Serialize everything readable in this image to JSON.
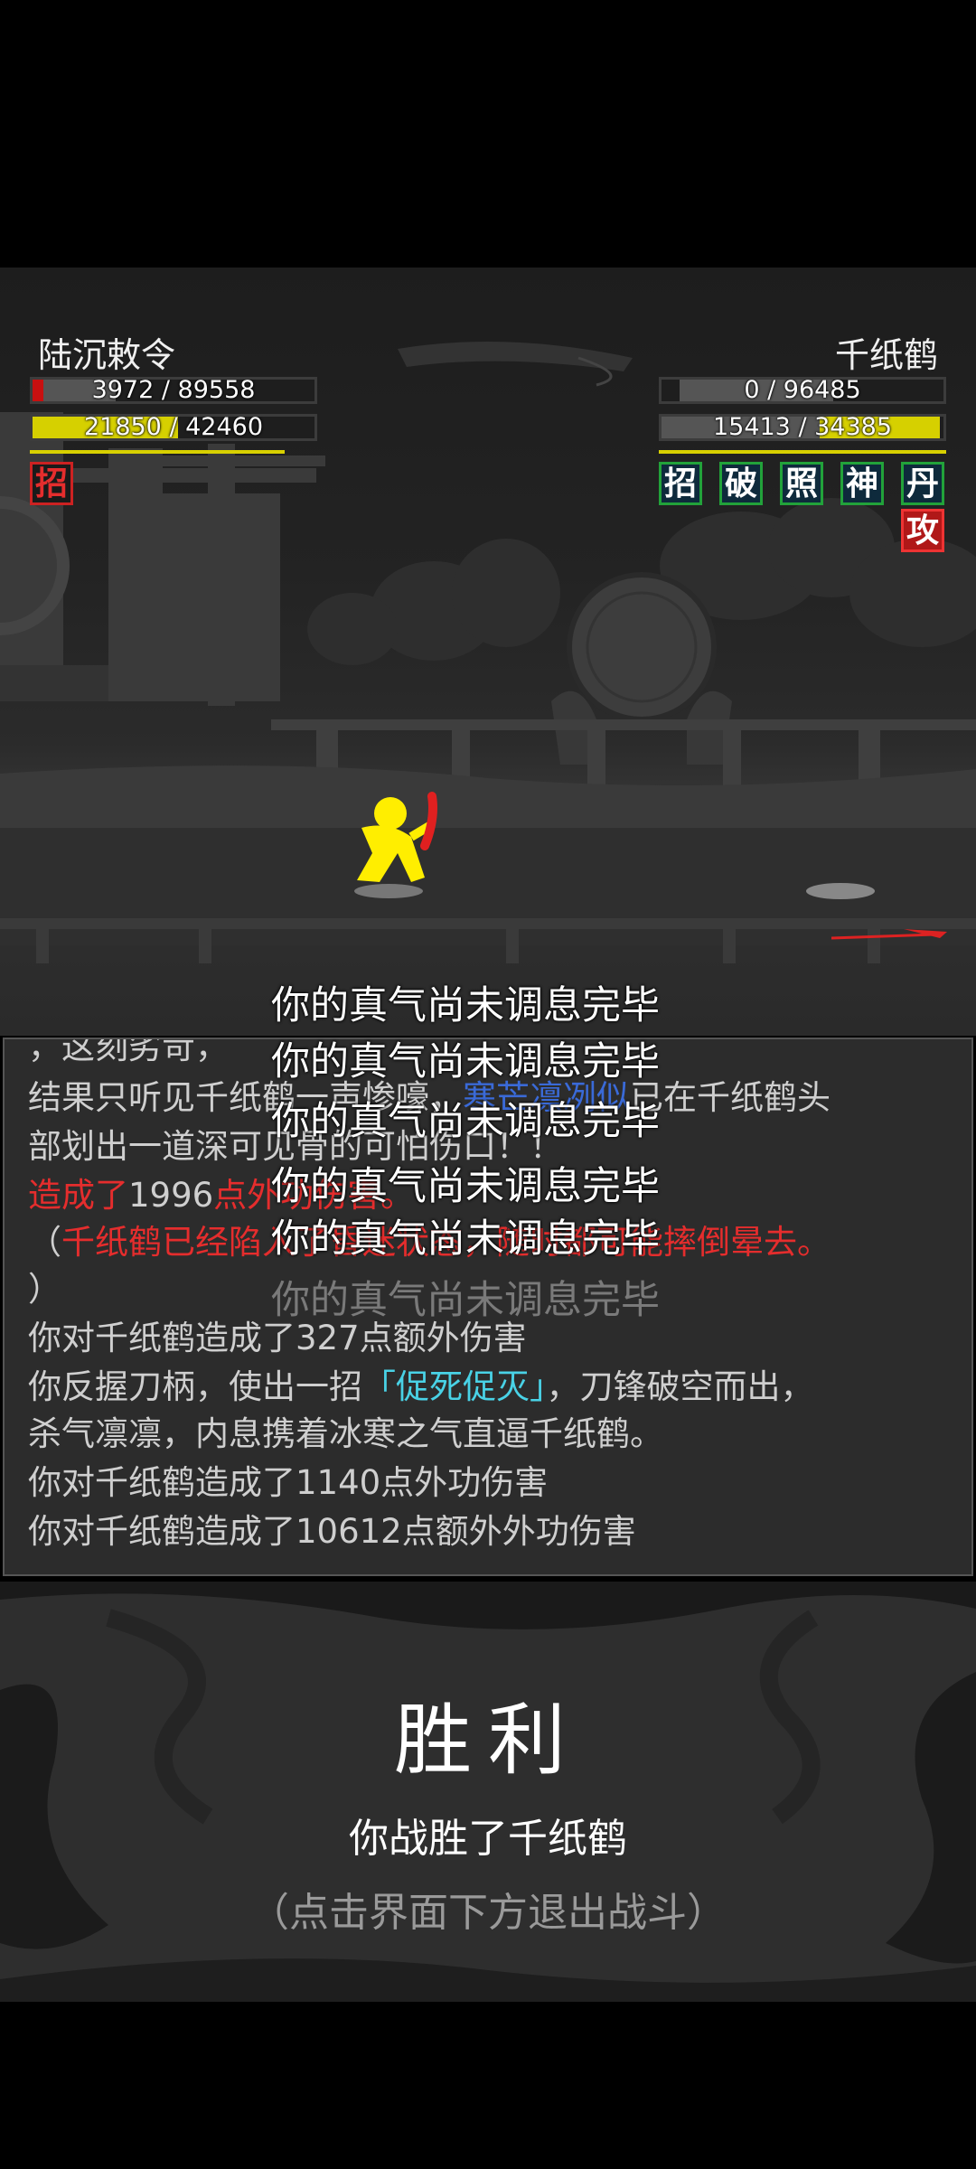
{
  "player": {
    "name": "陆沉敕令",
    "hp": "3972 / 89558",
    "hp_fraction": 0.044,
    "qi": "21850 / 42460",
    "qi_fraction": 0.515,
    "skills": [
      "招"
    ]
  },
  "enemy": {
    "name": "千纸鹤",
    "hp": "0 / 96485",
    "hp_fraction": 0.0,
    "qi": "15413 / 34385",
    "qi_fraction": 0.448,
    "skills": [
      "招",
      "破",
      "照",
      "神",
      "丹"
    ],
    "status": "攻"
  },
  "floating_messages": [
    "你的真气尚未调息完毕",
    "你的真气尚未调息完毕",
    "你的真气尚未调息完毕",
    "你的真气尚未调息完毕",
    "你的真气尚未调息完毕",
    "你的真气尚未调息完毕"
  ],
  "log": {
    "l0": "，这刻劣苛，",
    "l1a": "结果只听见千纸鹤一声惨嚎，",
    "l1b": "寒芒凛冽似",
    "l1c": "已在千纸鹤头",
    "l2": "部划出一道深可见骨的可怕伤口！！",
    "l3a": "造成了",
    "l3b": "1996",
    "l3c": "点外功伤害。",
    "l4a": "（",
    "l4b": "千纸鹤已经陷入了昏迷状态，随时都可能摔倒晕去。",
    "l5": "）",
    "l6": "你对千纸鹤造成了327点额外伤害",
    "l7a": "你反握刀柄，使出一招",
    "l7b": "「促死促灭」",
    "l7c": "，刀锋破空而出，",
    "l8": "杀气凛凛，内息携着冰寒之气直逼千纸鹤。",
    "l9": "你对千纸鹤造成了1140点外功伤害",
    "l10": "你对千纸鹤造成了10612点额外外功伤害"
  },
  "victory": {
    "title": "胜利",
    "subtitle": "你战胜了千纸鹤",
    "hint": "（点击界面下方退出战斗）"
  }
}
